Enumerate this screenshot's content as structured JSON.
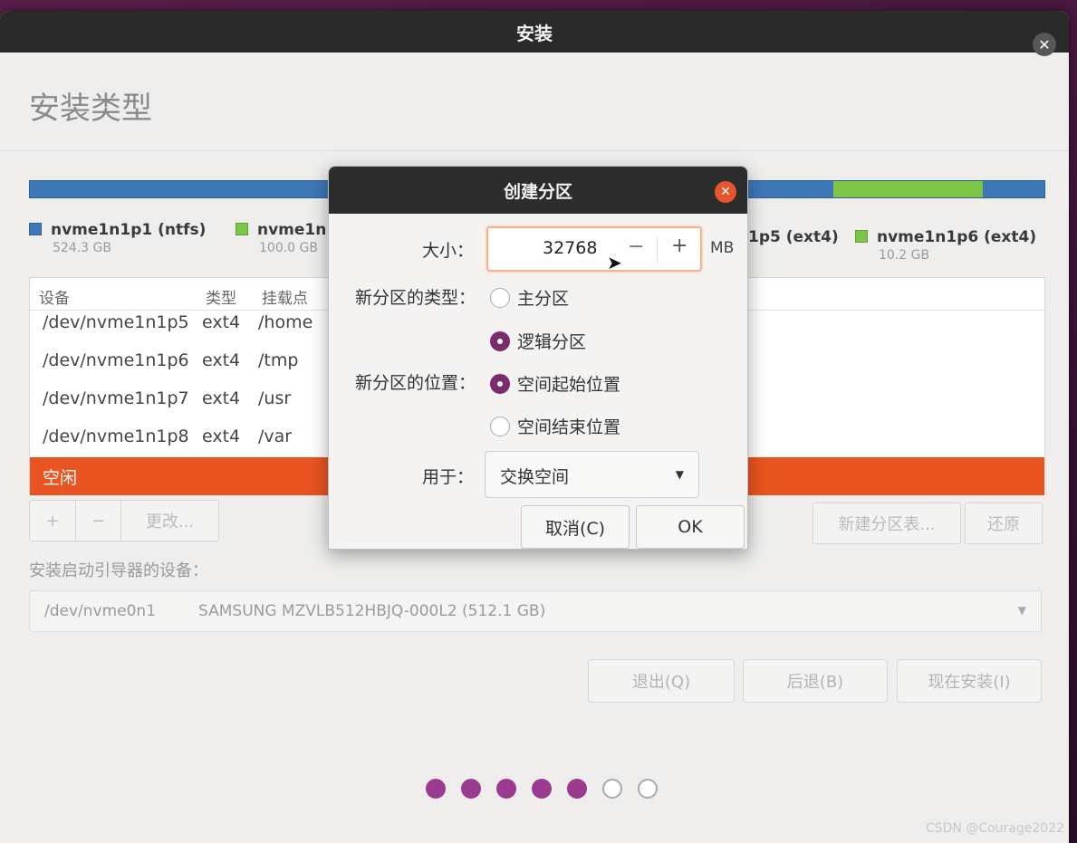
{
  "window": {
    "title": "安装"
  },
  "page": {
    "title": "安装类型"
  },
  "partitions": [
    {
      "name": "nvme1n1p1 (ntfs)",
      "size": "524.3 GB",
      "color": "#3d78b8"
    },
    {
      "name": "nvme1n",
      "size": "100.0 GB",
      "color": "#7cc547"
    },
    {
      "name": "1p5 (ext4)",
      "size": "",
      "color": "#3d78b8"
    },
    {
      "name": "nvme1n1p6 (ext4)",
      "size": "10.2 GB",
      "color": "#7cc547"
    }
  ],
  "table": {
    "headers": {
      "device": "设备",
      "type": "类型",
      "mount": "挂载点"
    },
    "rows": [
      {
        "device": "/dev/nvme1n1p5",
        "type": "ext4",
        "mount": "/home"
      },
      {
        "device": "/dev/nvme1n1p6",
        "type": "ext4",
        "mount": "/tmp"
      },
      {
        "device": "/dev/nvme1n1p7",
        "type": "ext4",
        "mount": "/usr"
      },
      {
        "device": "/dev/nvme1n1p8",
        "type": "ext4",
        "mount": "/var"
      }
    ],
    "selected": {
      "device": "空闲"
    }
  },
  "toolbar": {
    "add": "+",
    "remove": "−",
    "change": "更改...",
    "new_table": "新建分区表...",
    "revert": "还原"
  },
  "boot": {
    "label": "安装启动引导器的设备：",
    "device": "/dev/nvme0n1",
    "model": "SAMSUNG MZVLB512HBJQ-000L2 (512.1 GB)"
  },
  "nav": {
    "quit": "退出(Q)",
    "back": "后退(B)",
    "install": "现在安装(I)"
  },
  "progress": {
    "total": 7,
    "done": 5
  },
  "dialog": {
    "title": "创建分区",
    "size_label": "大小：",
    "size_value": "32768",
    "size_unit": "MB",
    "type_label": "新分区的类型：",
    "type_primary": "主分区",
    "type_logical": "逻辑分区",
    "location_label": "新分区的位置：",
    "location_start": "空间起始位置",
    "location_end": "空间结束位置",
    "use_label": "用于：",
    "use_value": "交换空间",
    "cancel": "取消(C)",
    "ok": "OK"
  },
  "watermark": "CSDN @Courage2022",
  "colors": {
    "accent": "#e95420",
    "radio": "#7a2a6e",
    "dots": "#9b3b8f"
  }
}
